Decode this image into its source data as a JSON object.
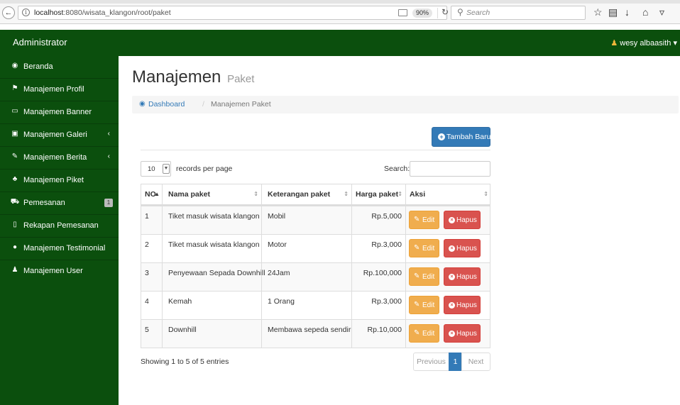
{
  "browser": {
    "url_host": "localhost",
    "url_path": ":8080/wisata_klangon/root/paket",
    "zoom": "90%",
    "search_placeholder": "Search"
  },
  "navbar": {
    "brand": "Administrator",
    "user_name": "wesy albaasith",
    "user_caret": "▾"
  },
  "sidebar": {
    "items": [
      {
        "label": "Beranda",
        "icon": "dashboard-icon",
        "glyph": "◉"
      },
      {
        "label": "Manajemen Profil",
        "icon": "flag-icon",
        "glyph": "⚑"
      },
      {
        "label": "Manajemen Banner",
        "icon": "desktop-icon",
        "glyph": "▭"
      },
      {
        "label": "Manajemen Galeri",
        "icon": "image-icon",
        "glyph": "▣",
        "chevron": "‹"
      },
      {
        "label": "Manajemen Berita",
        "icon": "pencil-icon",
        "glyph": "✎",
        "chevron": "‹"
      },
      {
        "label": "Manajemen Piket",
        "icon": "users-icon",
        "glyph": "♣"
      },
      {
        "label": "Pemesanan",
        "icon": "cart-icon",
        "glyph": "⛟",
        "badge": "1"
      },
      {
        "label": "Rekapan Pemesanan",
        "icon": "file-icon",
        "glyph": "▯"
      },
      {
        "label": "Manajemen Testimonial",
        "icon": "comments-icon",
        "glyph": "●"
      },
      {
        "label": "Manajemen User",
        "icon": "group-icon",
        "glyph": "♟"
      }
    ]
  },
  "page": {
    "title": "Manajemen",
    "subtitle": "Paket",
    "breadcrumb_home": "Dashboard",
    "breadcrumb_sep": "/",
    "breadcrumb_current": "Manajemen Paket",
    "add_button": "Tambah Baru"
  },
  "datatable": {
    "length_value": "10",
    "length_label": "records per page",
    "search_label": "Search:",
    "search_value": "",
    "headers": {
      "no": "NO",
      "nama": "Nama paket",
      "keterangan": "Keterangan paket",
      "harga": "Harga paket",
      "aksi": "Aksi"
    },
    "rows": [
      {
        "no": "1",
        "nama": "Tiket masuk wisata klangon",
        "keterangan": "Mobil",
        "harga": "Rp.5,000"
      },
      {
        "no": "2",
        "nama": "Tiket masuk wisata klangon",
        "keterangan": "Motor",
        "harga": "Rp.3,000"
      },
      {
        "no": "3",
        "nama": "Penyewaan Sepada Downhill",
        "keterangan": "24Jam",
        "harga": "Rp.100,000"
      },
      {
        "no": "4",
        "nama": "Kemah",
        "keterangan": "1 Orang",
        "harga": "Rp.3,000"
      },
      {
        "no": "5",
        "nama": "Downhill",
        "keterangan": "Membawa sepeda sendiri",
        "harga": "Rp.10,000"
      }
    ],
    "edit_label": "Edit",
    "delete_label": "Hapus",
    "info": "Showing 1 to 5 of 5 entries",
    "pagination": {
      "previous": "Previous",
      "current": "1",
      "next": "Next"
    }
  },
  "colors": {
    "navbar_bg": "#0b4f0d",
    "primary": "#337ab7",
    "warning": "#f0ad4e",
    "danger": "#d9534f"
  }
}
